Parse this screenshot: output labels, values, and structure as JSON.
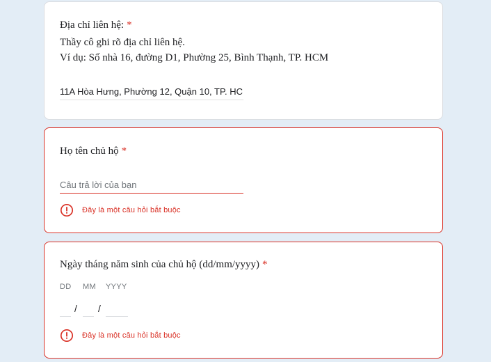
{
  "address_question": {
    "title": "Địa chỉ liên hệ:",
    "required_mark": "*",
    "description_line1": "Thầy cô ghi rõ địa chỉ liên hệ.",
    "description_line2": "Ví dụ: Số nhà 16, đường D1, Phường 25, Bình Thạnh, TP. HCM",
    "value": "11A Hòa Hưng, Phường 12, Quận 10, TP. HCM"
  },
  "name_question": {
    "title": "Họ tên chủ hộ",
    "required_mark": "*",
    "placeholder": "Câu trả lời của bạn",
    "value": "",
    "error_text": "Đây là một câu hỏi bắt buộc"
  },
  "dob_question": {
    "title": "Ngày tháng năm sinh của chủ hộ (dd/mm/yyyy)",
    "required_mark": "*",
    "day_label": "DD",
    "month_label": "MM",
    "year_label": "YYYY",
    "separator": "/",
    "day_value": "",
    "month_value": "",
    "year_value": "",
    "error_text": "Đây là một câu hỏi bắt buộc"
  },
  "colors": {
    "background": "#e3edf6",
    "error": "#d93025",
    "text": "#202124"
  },
  "icons": {
    "error": "error-circle-icon"
  }
}
